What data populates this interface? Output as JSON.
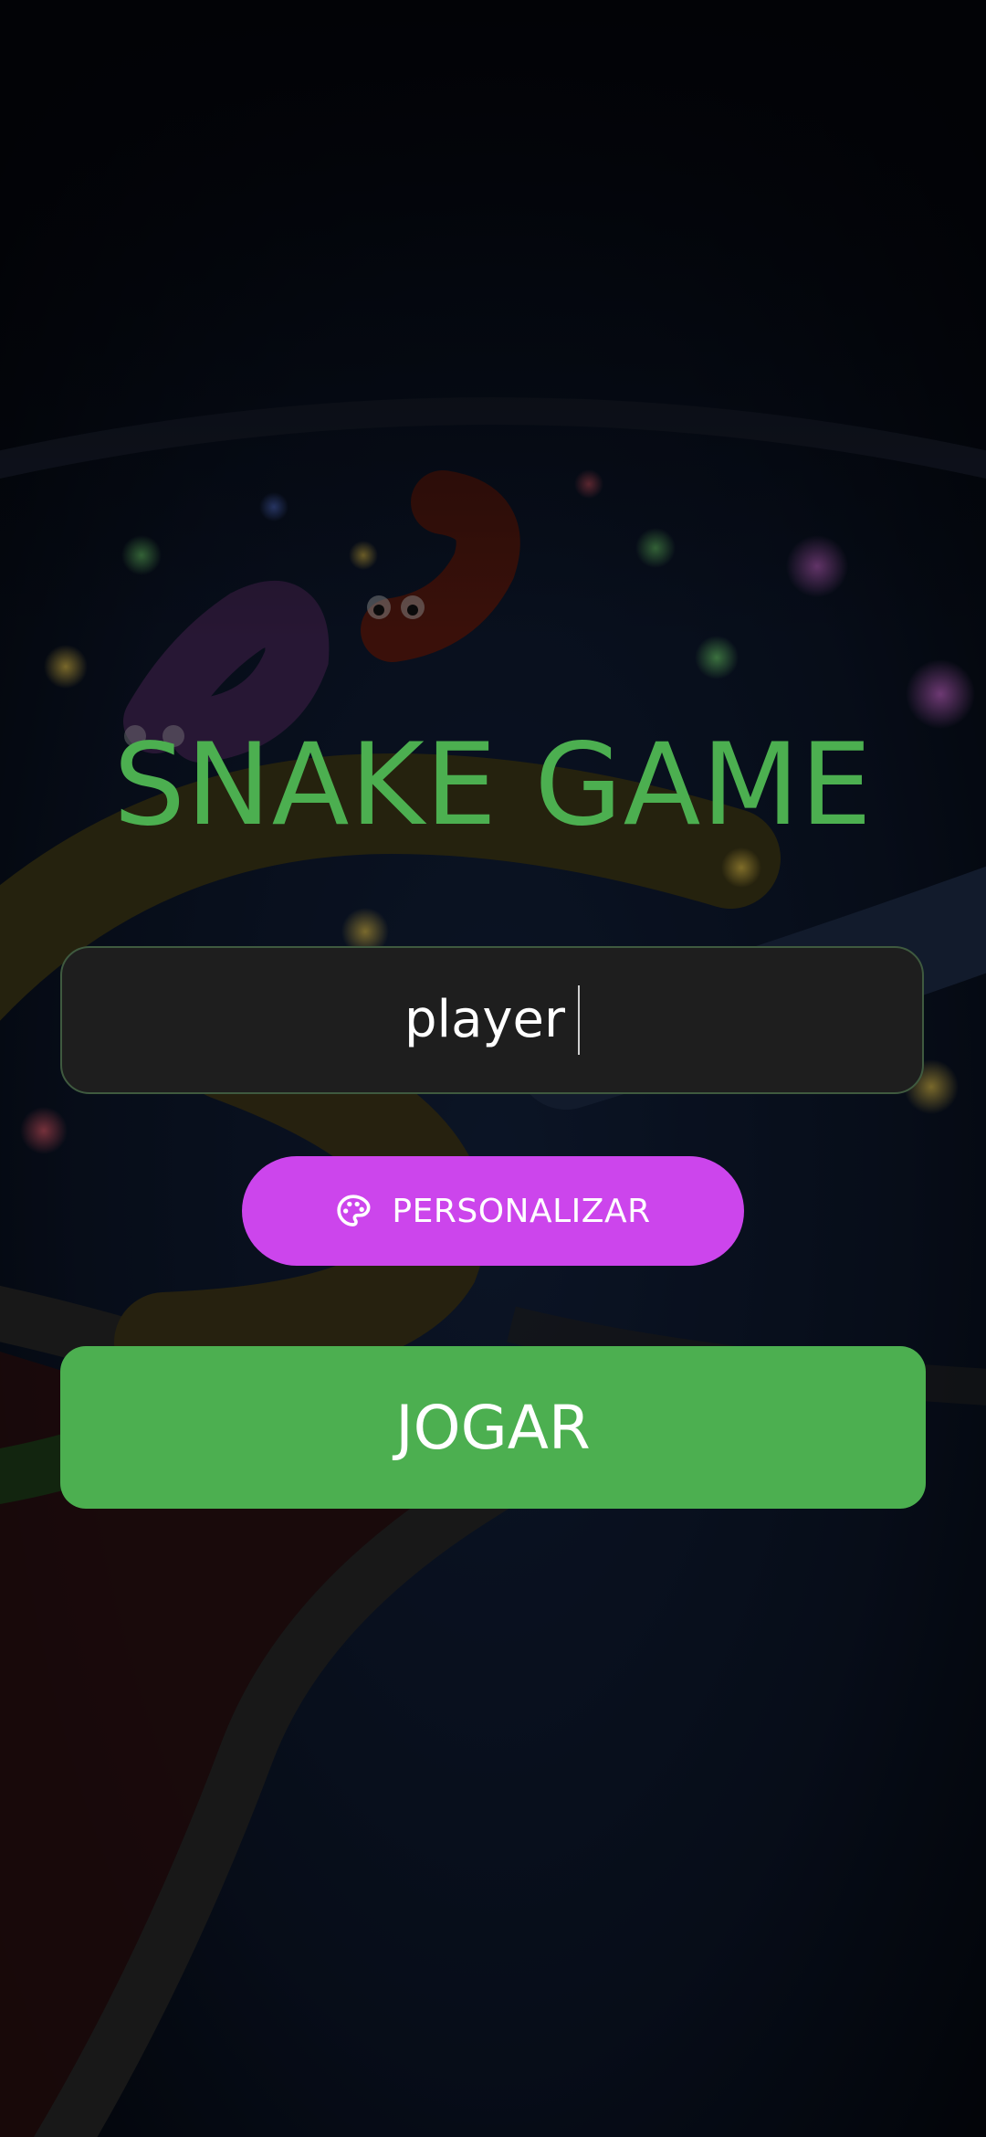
{
  "game": {
    "title": "SNAKE GAME"
  },
  "name_input": {
    "value": "player"
  },
  "buttons": {
    "customize_label": "PERSONALIZAR",
    "customize_icon": "palette-icon",
    "play_label": "JOGAR"
  },
  "colors": {
    "accent_green": "#4caf50",
    "customize_purple": "#cc45ec",
    "input_bg": "#1e1e1e"
  }
}
